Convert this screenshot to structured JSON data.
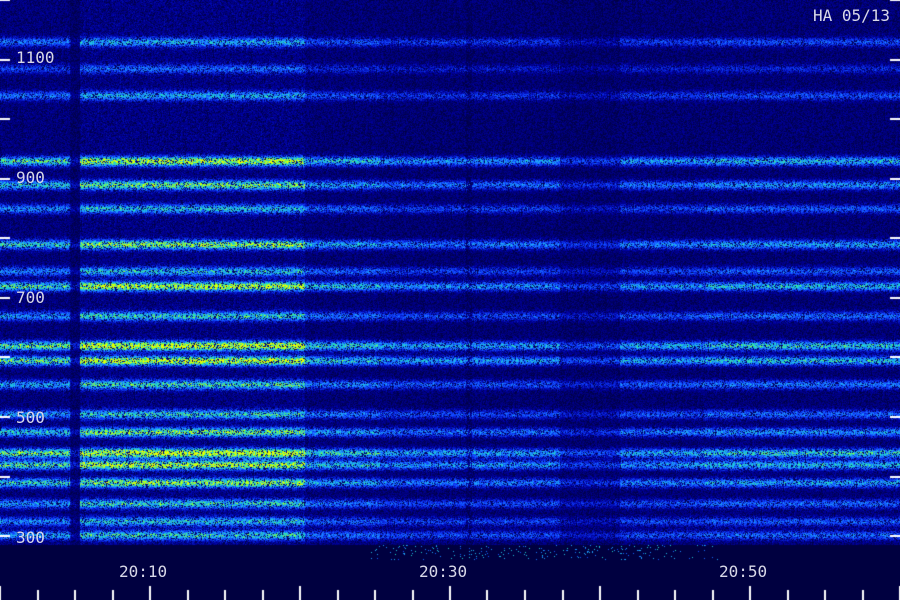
{
  "chart_data": {
    "type": "heatmap",
    "title": "HA 05/13",
    "x_tick_labels": [
      "20:10",
      "20:30",
      "20:50"
    ],
    "x_tick_minutes": [
      10,
      30,
      50
    ],
    "xlim_minutes": [
      0,
      60
    ],
    "y_tick_labels": [
      "1100",
      "900",
      "700",
      "500",
      "300"
    ],
    "y_tick_values": [
      1100,
      900,
      700,
      500,
      300
    ],
    "ylim": [
      285,
      1200
    ],
    "bands_y": [
      1130,
      1085,
      1040,
      930,
      890,
      850,
      790,
      745,
      720,
      670,
      620,
      595,
      555,
      505,
      475,
      440,
      420,
      390,
      355,
      325,
      302
    ],
    "bands_strength": [
      0.45,
      0.3,
      0.45,
      0.85,
      0.7,
      0.5,
      0.75,
      0.5,
      0.85,
      0.55,
      0.95,
      0.9,
      0.6,
      0.55,
      0.7,
      0.95,
      0.85,
      0.75,
      0.55,
      0.5,
      0.55
    ],
    "quiet_start_minutes": 31,
    "colormap": [
      "#000040",
      "#0000a0",
      "#1040ff",
      "#20a0ff",
      "#20e0c0",
      "#a0ff20",
      "#f0ff00"
    ]
  }
}
